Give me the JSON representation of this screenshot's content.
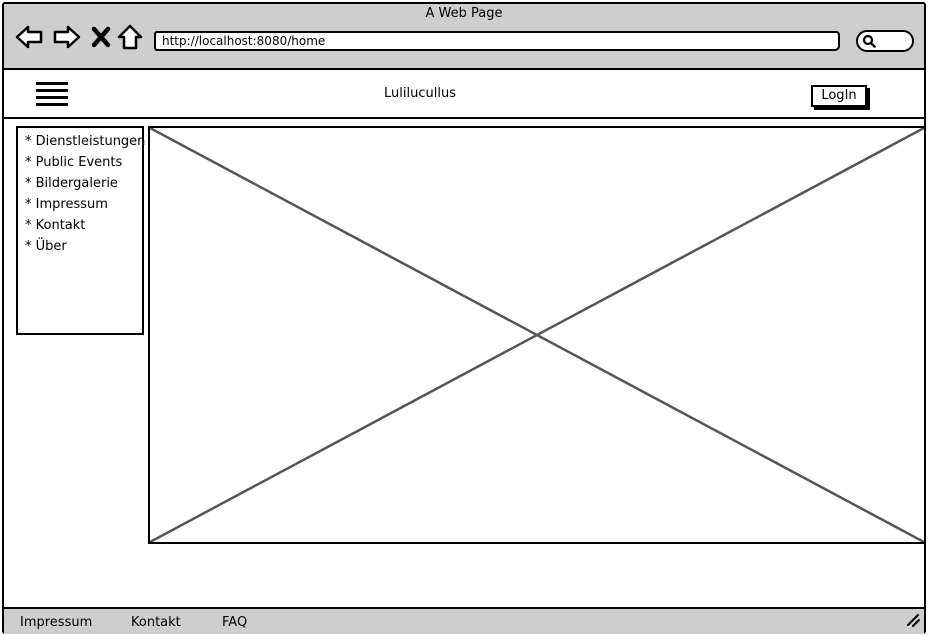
{
  "browser": {
    "window_title": "A Web Page",
    "url": "http://localhost:8080/home",
    "nav": {
      "back_icon": "back-arrow-icon",
      "forward_icon": "forward-arrow-icon",
      "stop_icon": "stop-x-icon",
      "home_icon": "home-icon"
    },
    "search_icon": "search-icon"
  },
  "header": {
    "menu_icon": "hamburger-menu-icon",
    "brand": "Lulilucullus",
    "login_label": "LogIn"
  },
  "sidebar": {
    "items": [
      {
        "label": "* Dienstleistungen"
      },
      {
        "label": "* Public Events"
      },
      {
        "label": "* Bildergalerie"
      },
      {
        "label": "* Impressum"
      },
      {
        "label": "* Kontakt"
      },
      {
        "label": "* Über"
      }
    ]
  },
  "main": {
    "image_placeholder_icon": "image-placeholder-icon"
  },
  "footer": {
    "links": [
      {
        "label": "Impressum"
      },
      {
        "label": "Kontakt"
      },
      {
        "label": "FAQ"
      }
    ],
    "resize_icon": "resize-grip-icon"
  }
}
